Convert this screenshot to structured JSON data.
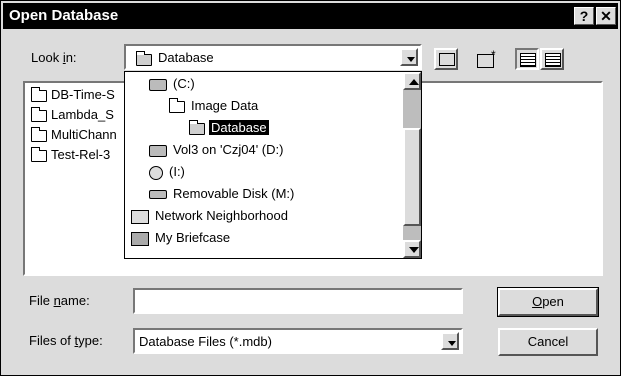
{
  "title": "Open Database",
  "title_buttons": {
    "help": "?",
    "close": "✕"
  },
  "look_in": {
    "label_pre": "Look ",
    "label_key": "i",
    "label_post": "n:",
    "value": "Database"
  },
  "toolbar": {
    "icons": [
      "up-one-level-icon",
      "create-new-folder-icon",
      "list-view-icon",
      "details-view-icon"
    ]
  },
  "files": [
    "DB-Time-S",
    "Lambda_S",
    "MultiChann",
    "Test-Rel-3"
  ],
  "dropdown_items": [
    {
      "label": "(C:)",
      "icon": "hard-drive-icon",
      "indent": 1
    },
    {
      "label": "Image Data",
      "icon": "folder-icon",
      "indent": 2
    },
    {
      "label": "Database",
      "icon": "open-folder-icon",
      "indent": 3,
      "selected": true
    },
    {
      "label": "Vol3 on 'Czj04' (D:)",
      "icon": "network-drive-icon",
      "indent": 1
    },
    {
      "label": "(I:)",
      "icon": "cd-drive-icon",
      "indent": 1
    },
    {
      "label": "Removable Disk (M:)",
      "icon": "removable-drive-icon",
      "indent": 1
    },
    {
      "label": "Network Neighborhood",
      "icon": "network-neighborhood-icon",
      "indent": 0
    },
    {
      "label": "My Briefcase",
      "icon": "briefcase-icon",
      "indent": 0
    }
  ],
  "file_name": {
    "label_pre": "File ",
    "label_key": "n",
    "label_post": "ame:",
    "value": ""
  },
  "file_type": {
    "label_pre": "Files of ",
    "label_key": "t",
    "label_post": "ype:",
    "value": "Database Files (*.mdb)"
  },
  "buttons": {
    "open_key": "O",
    "open_rest": "pen",
    "cancel": "Cancel"
  }
}
